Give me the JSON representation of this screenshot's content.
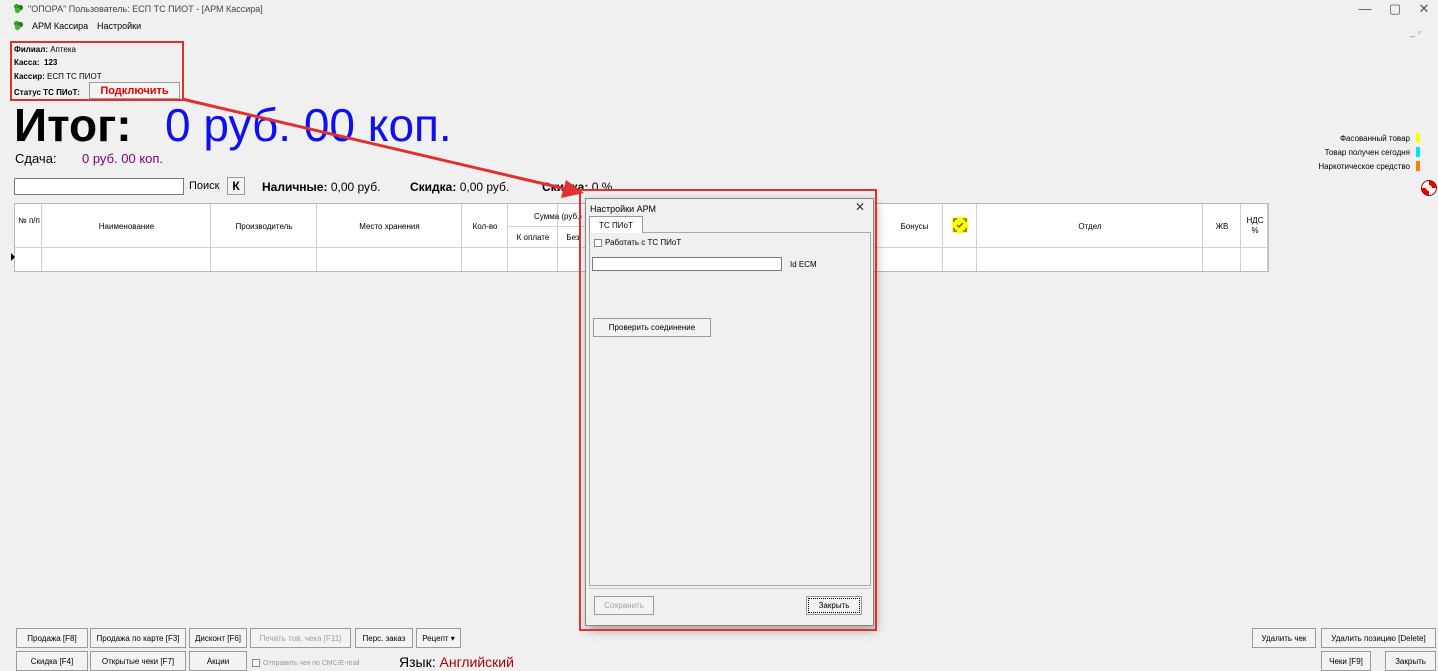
{
  "window": {
    "title": "\"ОПОРА\" Пользователь: ЕСП ТС ПИОТ - [АРМ Кассира]",
    "minimize": "—",
    "maximize": "▢",
    "close": "✕",
    "mdi_controls": "_ ▫"
  },
  "menu": {
    "items": [
      "АРМ Кассира",
      "Настройки"
    ]
  },
  "info": {
    "branch_label": "Филиал:",
    "branch_value": "Аптека",
    "register_label": "Касса:",
    "register_value": "123",
    "cashier_label": "Кассир:",
    "cashier_value": "ЕСП ТС ПИОТ",
    "status_label": "Статус ТС ПИоТ:",
    "connect_button": "Подключить"
  },
  "totals": {
    "total_label": "Итог:",
    "total_value": "0 руб. 00 коп.",
    "change_label": "Сдача:",
    "change_value": "0 руб. 00 коп."
  },
  "legend": {
    "items": [
      {
        "label": "Фасованный товар",
        "color": "#ffff00"
      },
      {
        "label": "Товар получен сегодня",
        "color": "#00e0ff"
      },
      {
        "label": "Наркотическое средство",
        "color": "#ff8000"
      }
    ]
  },
  "search": {
    "label": "Поиск",
    "k_button": "К",
    "cash_label": "Наличные:",
    "cash_value": "0,00 руб.",
    "discount_label": "Скидка:",
    "discount_value": "0,00 руб.",
    "discount_pct_label": "Скидка:",
    "discount_pct_value": "0 %"
  },
  "grid": {
    "headers": [
      "№ п/п",
      "Наименование",
      "Производитель",
      "Место хранения",
      "Кол-во",
      "Сумма (руб.)",
      "К оплате",
      "Без",
      "Бонусы",
      "Отдел",
      "ЖВ",
      "НДС %"
    ]
  },
  "bottom": {
    "row1": [
      "Продажа [F8]",
      "Продажа по карте [F3]",
      "Дисконт [F6]",
      "Печать тов. чека [F11]",
      "Перс. заказ",
      "Рецепт ▾"
    ],
    "row1_right": [
      "Удалить чек",
      "Удалить позицию [Delete]"
    ],
    "row2": [
      "Скидка [F4]",
      "Открытые чеки [F7]",
      "Акции"
    ],
    "sms_check": "Отправить чек по СМС/E-mail",
    "lang_label": "Язык:",
    "lang_value": "Английский",
    "row2_right": [
      "Чеки [F9]",
      "Закрыть"
    ]
  },
  "dialog": {
    "title": "Настройки АРМ",
    "close": "✕",
    "tab": "ТС ПИоТ",
    "work_check": "Работать с ТС ПИоТ",
    "idecm_label": "Id ECM",
    "idecm_value": "",
    "check_button": "Проверить соединение",
    "save_button": "Сохранить",
    "close_button": "Закрыть"
  }
}
